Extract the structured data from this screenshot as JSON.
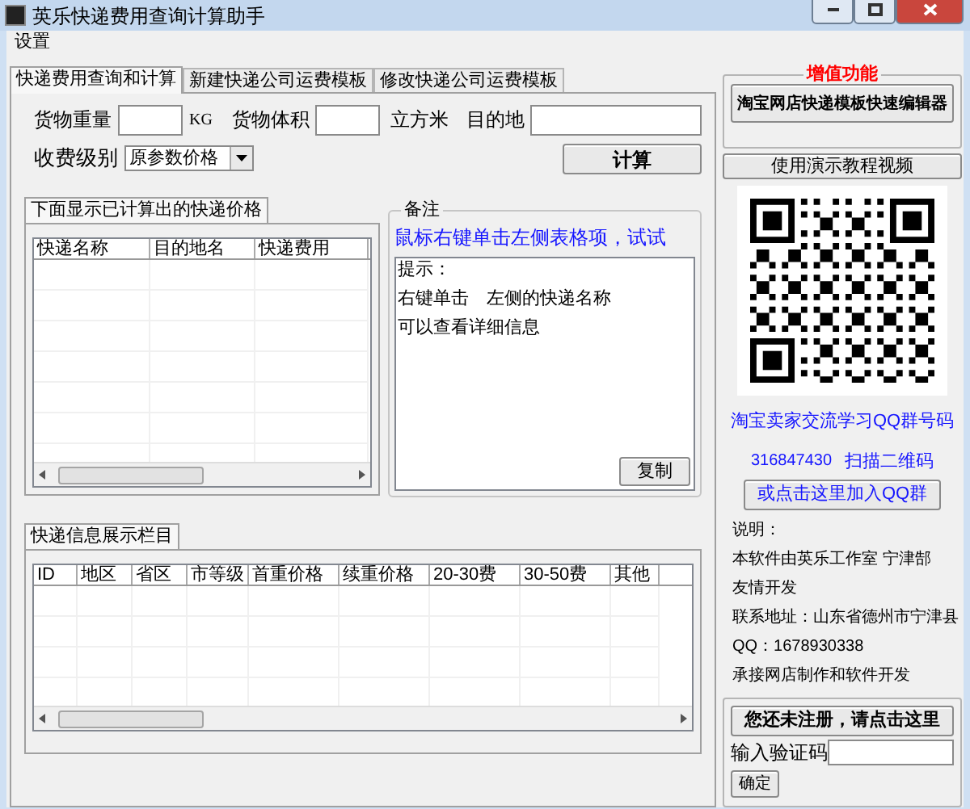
{
  "window": {
    "title": "英乐快递费用查询计算助手"
  },
  "menu": [
    "设置"
  ],
  "tabs": [
    {
      "label": "快递费用查询和计算",
      "selected": true
    },
    {
      "label": "新建快递公司运费模板",
      "selected": false
    },
    {
      "label": "修改快递公司运费模板",
      "selected": false
    }
  ],
  "form": {
    "weight_label": "货物重量",
    "weight_unit": "KG",
    "volume_label": "货物体积",
    "volume_unit": "立方米",
    "destination_label": "目的地",
    "level_label": "收费级别",
    "level_value": "原参数价格",
    "calculate_button": "计算"
  },
  "results": {
    "tab": "下面显示已计算出的快递价格",
    "columns": [
      "快递名称",
      "目的地名",
      "快递费用"
    ]
  },
  "notes": {
    "title": "备注",
    "hint": "鼠标右键单击左侧表格项，试试",
    "lines": [
      "提示：",
      "右键单击　左侧的快递名称",
      "可以查看详细信息"
    ],
    "copy_button": "复制"
  },
  "info": {
    "tab": "快递信息展示栏目",
    "columns": [
      "ID",
      "地区",
      "省区",
      "市等级",
      "首重价格",
      "续重价格",
      "20-30费",
      "30-50费",
      "其他"
    ]
  },
  "sidebar": {
    "value_added_title": "增值功能",
    "editor_button": "淘宝网店快递模板快速编辑器",
    "video_button": "使用演示教程视频",
    "qq_group_label": "淘宝卖家交流学习QQ群号码",
    "qq_group_number": "316847430",
    "scan_label": "扫描二维码",
    "join_button": "或点击这里加入QQ群",
    "about_lines": [
      "说明：",
      "本软件由英乐工作室 宁津郜",
      "友情开发",
      "联系地址：山东省德州市宁津县",
      "QQ：1678930338",
      "承接网店制作和软件开发"
    ],
    "register_button": "您还未注册，请点击这里",
    "code_label": "输入验证码",
    "confirm_button": "确定"
  }
}
